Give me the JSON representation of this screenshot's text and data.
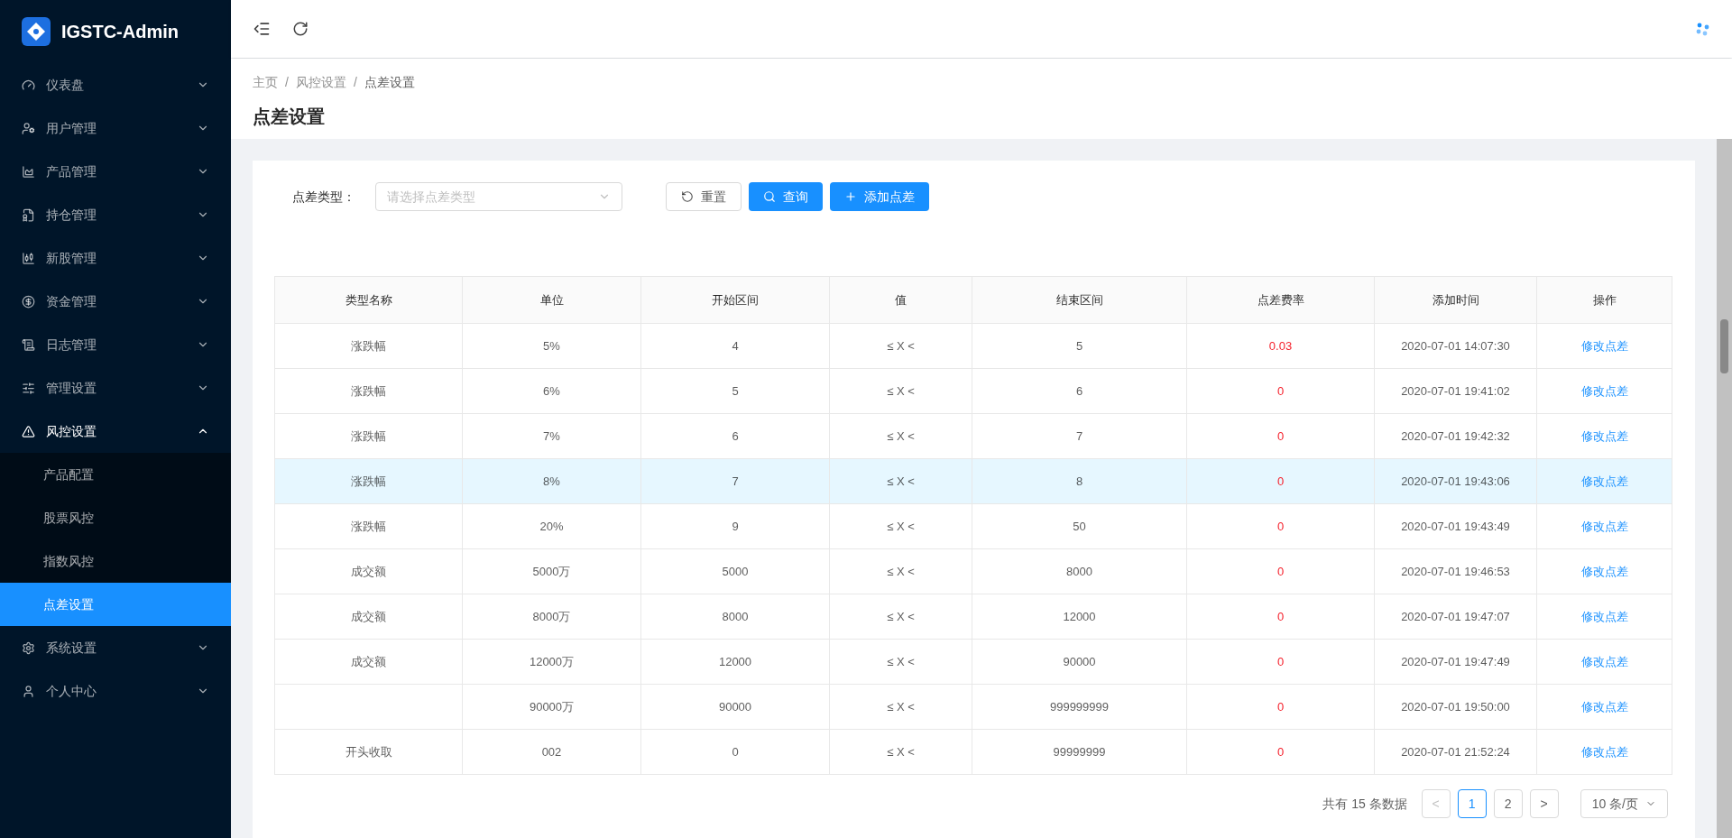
{
  "brand": {
    "title": "IGSTC-Admin"
  },
  "sidebar": {
    "items": [
      {
        "label": "仪表盘",
        "expanded": false
      },
      {
        "label": "用户管理",
        "expanded": false
      },
      {
        "label": "产品管理",
        "expanded": false
      },
      {
        "label": "持仓管理",
        "expanded": false
      },
      {
        "label": "新股管理",
        "expanded": false
      },
      {
        "label": "资金管理",
        "expanded": false
      },
      {
        "label": "日志管理",
        "expanded": false
      },
      {
        "label": "管理设置",
        "expanded": false
      },
      {
        "label": "风控设置",
        "expanded": true,
        "children": [
          {
            "label": "产品配置",
            "selected": false
          },
          {
            "label": "股票风控",
            "selected": false
          },
          {
            "label": "指数风控",
            "selected": false
          },
          {
            "label": "点差设置",
            "selected": true
          }
        ]
      },
      {
        "label": "系统设置",
        "expanded": false
      },
      {
        "label": "个人中心",
        "expanded": false
      }
    ]
  },
  "breadcrumb": {
    "separator": "/",
    "items": [
      "主页",
      "风控设置",
      "点差设置"
    ]
  },
  "page_title": "点差设置",
  "filter": {
    "label": "点差类型：",
    "placeholder": "请选择点差类型"
  },
  "buttons": [
    {
      "label": "重置",
      "kind": "reset"
    },
    {
      "label": "查询",
      "kind": "search"
    },
    {
      "label": "添加点差",
      "kind": "add"
    }
  ],
  "table": {
    "columns": [
      "类型名称",
      "单位",
      "开始区间",
      "值",
      "结束区间",
      "点差费率",
      "添加时间",
      "操作"
    ],
    "rows": [
      {
        "type": "涨跌幅",
        "unit": "5%",
        "start": "4",
        "value": "≤ X <",
        "end": "5",
        "rate": "0.03",
        "time": "2020-07-01 14:07:30",
        "action": "修改点差",
        "hovered": false
      },
      {
        "type": "涨跌幅",
        "unit": "6%",
        "start": "5",
        "value": "≤ X <",
        "end": "6",
        "rate": "0",
        "time": "2020-07-01 19:41:02",
        "action": "修改点差",
        "hovered": false
      },
      {
        "type": "涨跌幅",
        "unit": "7%",
        "start": "6",
        "value": "≤ X <",
        "end": "7",
        "rate": "0",
        "time": "2020-07-01 19:42:32",
        "action": "修改点差",
        "hovered": false
      },
      {
        "type": "涨跌幅",
        "unit": "8%",
        "start": "7",
        "value": "≤ X <",
        "end": "8",
        "rate": "0",
        "time": "2020-07-01 19:43:06",
        "action": "修改点差",
        "hovered": true
      },
      {
        "type": "涨跌幅",
        "unit": "20%",
        "start": "9",
        "value": "≤ X <",
        "end": "50",
        "rate": "0",
        "time": "2020-07-01 19:43:49",
        "action": "修改点差",
        "hovered": false
      },
      {
        "type": "成交额",
        "unit": "5000万",
        "start": "5000",
        "value": "≤ X <",
        "end": "8000",
        "rate": "0",
        "time": "2020-07-01 19:46:53",
        "action": "修改点差",
        "hovered": false
      },
      {
        "type": "成交额",
        "unit": "8000万",
        "start": "8000",
        "value": "≤ X <",
        "end": "12000",
        "rate": "0",
        "time": "2020-07-01 19:47:07",
        "action": "修改点差",
        "hovered": false
      },
      {
        "type": "成交额",
        "unit": "12000万",
        "start": "12000",
        "value": "≤ X <",
        "end": "90000",
        "rate": "0",
        "time": "2020-07-01 19:47:49",
        "action": "修改点差",
        "hovered": false
      },
      {
        "unit": "90000万",
        "start": "90000",
        "value": "≤ X <",
        "end": "999999999",
        "rate": "0",
        "time": "2020-07-01 19:50:00",
        "action": "修改点差",
        "hovered": false
      },
      {
        "type": "开头收取",
        "unit": "002",
        "start": "0",
        "value": "≤ X <",
        "end": "99999999",
        "rate": "0",
        "time": "2020-07-01 21:52:24",
        "action": "修改点差",
        "hovered": false
      }
    ]
  },
  "pagination": {
    "total": "共有 15 条数据",
    "prev": "<",
    "pages": [
      {
        "label": "1",
        "selected": true
      },
      {
        "label": "2",
        "selected": false
      }
    ],
    "next": ">",
    "page_size": "10 条/页"
  }
}
